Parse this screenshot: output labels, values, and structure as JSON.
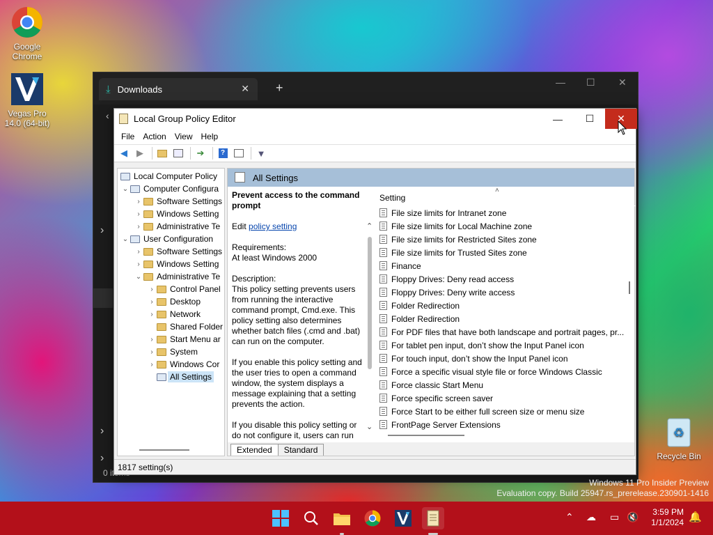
{
  "desktop": {
    "icons": [
      {
        "label_line1": "Google",
        "label_line2": "Chrome"
      },
      {
        "label_line1": "Vegas Pro",
        "label_line2": "14.0 (64-bit)"
      },
      {
        "label_line1": "Recycle Bin",
        "label_line2": ""
      }
    ]
  },
  "downloads_window": {
    "tab_title": "Downloads",
    "status": "0 items"
  },
  "gpe": {
    "title": "Local Group Policy Editor",
    "menu": [
      "File",
      "Action",
      "View",
      "Help"
    ],
    "tree": [
      {
        "label": "Local Computer Policy",
        "level": 0
      },
      {
        "label": "Computer Configura",
        "level": 0
      },
      {
        "label": "Software Settings",
        "level": 1
      },
      {
        "label": "Windows Setting",
        "level": 1
      },
      {
        "label": "Administrative Te",
        "level": 1
      },
      {
        "label": "User Configuration",
        "level": 0
      },
      {
        "label": "Software Settings",
        "level": 1
      },
      {
        "label": "Windows Setting",
        "level": 1
      },
      {
        "label": "Administrative Te",
        "level": 1
      },
      {
        "label": "Control Panel",
        "level": 2
      },
      {
        "label": "Desktop",
        "level": 2
      },
      {
        "label": "Network",
        "level": 2
      },
      {
        "label": "Shared Folder",
        "level": 2
      },
      {
        "label": "Start Menu ar",
        "level": 2
      },
      {
        "label": "System",
        "level": 2
      },
      {
        "label": "Windows Cor",
        "level": 2
      },
      {
        "label": "All Settings",
        "level": 2
      }
    ],
    "pane_header": "All Settings",
    "description": {
      "title": "Prevent access to the command prompt",
      "edit_prefix": "Edit ",
      "edit_link": "policy setting ",
      "requirements_label": "Requirements:",
      "requirements_value": "At least Windows 2000",
      "description_label": "Description:",
      "p1": "This policy setting prevents users from running the interactive command prompt, Cmd.exe.  This policy setting also determines whether batch files (.cmd and .bat) can run on the computer.",
      "p2": "If you enable this policy setting and the user tries to open a command window, the system displays a message explaining that a setting prevents the action.",
      "p3": "If you disable this policy setting or do not configure it, users can run"
    },
    "column_header": "Setting",
    "settings": [
      "File size limits for Intranet zone",
      "File size limits for Local Machine zone",
      "File size limits for Restricted Sites zone",
      "File size limits for Trusted Sites zone",
      "Finance",
      "Floppy Drives: Deny read access",
      "Floppy Drives: Deny write access",
      "Folder Redirection",
      "Folder Redirection",
      "For PDF files that have both landscape and portrait pages, pr...",
      "For tablet pen input, don’t show the Input Panel icon",
      "For touch input, don’t show the Input Panel icon",
      "Force a specific visual style file or force Windows Classic",
      "Force classic Start Menu",
      "Force specific screen saver",
      "Force Start to be either full screen size or menu size",
      "FrontPage Server Extensions"
    ],
    "tabs": [
      "Extended",
      "Standard"
    ],
    "status": "1817 setting(s)"
  },
  "watermark": {
    "line1": "Windows 11 Pro Insider Preview",
    "line2": "Evaluation copy. Build 25947.rs_prerelease.230901-1416"
  },
  "taskbar": {
    "time": "3:59 PM",
    "date": "1/1/2024",
    "colors": {
      "bar": "#b3101a",
      "close_hover": "#c42b1c"
    }
  }
}
